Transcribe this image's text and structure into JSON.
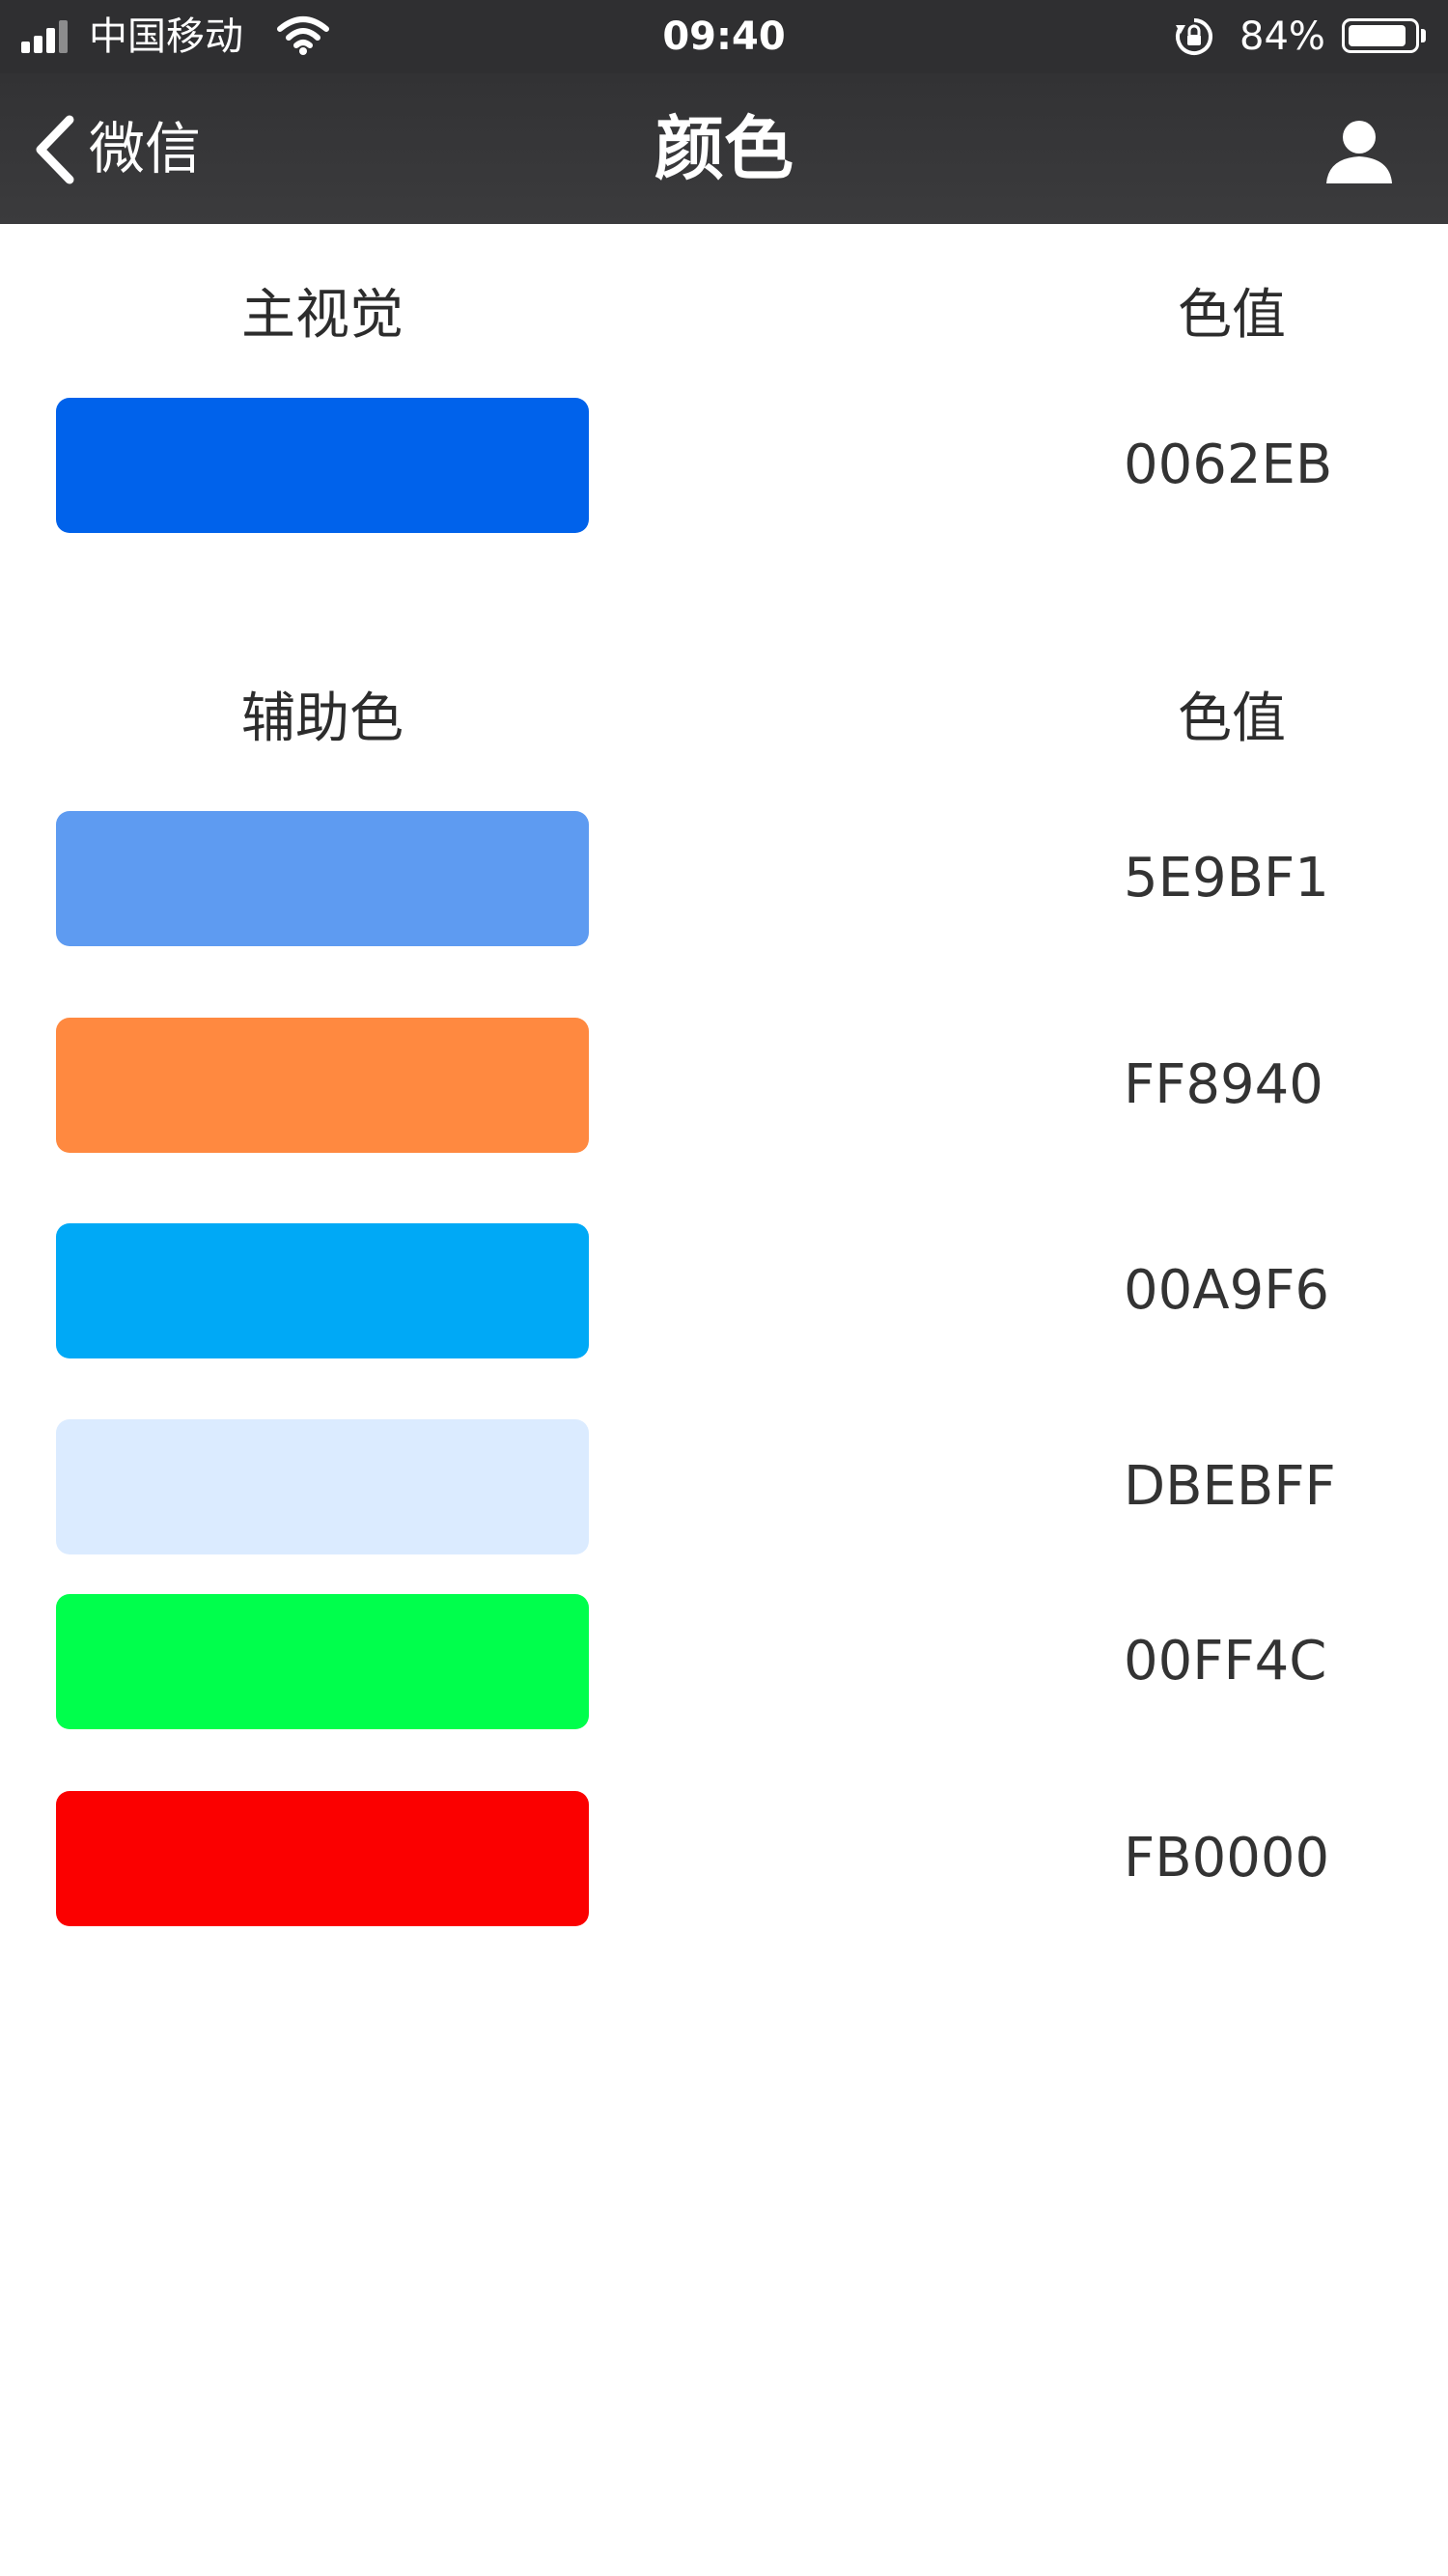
{
  "status_bar": {
    "carrier": "中国移动",
    "time": "09:40",
    "battery_percent": "84%",
    "battery_level": 0.84,
    "icons": [
      "signal-icon",
      "wifi-icon",
      "orientation-lock-icon",
      "battery-icon"
    ]
  },
  "nav": {
    "back_label": "微信",
    "title": "颜色",
    "icons": [
      "chevron-left-icon",
      "user-icon"
    ]
  },
  "primary": {
    "header": "主视觉",
    "value_header": "色值",
    "swatches": [
      {
        "color": "#0062EB",
        "label": "0062EB"
      }
    ]
  },
  "secondary": {
    "header": "辅助色",
    "value_header": "色值",
    "swatches": [
      {
        "color": "#5E9BF1",
        "label": "5E9BF1"
      },
      {
        "color": "#FF8940",
        "label": "FF8940"
      },
      {
        "color": "#00A9F6",
        "label": "00A9F6"
      },
      {
        "color": "#DBEBFF",
        "label": "DBEBFF"
      },
      {
        "color": "#00FF4C",
        "label": "00FF4C"
      },
      {
        "color": "#FB0000",
        "label": "FB0000"
      }
    ]
  }
}
